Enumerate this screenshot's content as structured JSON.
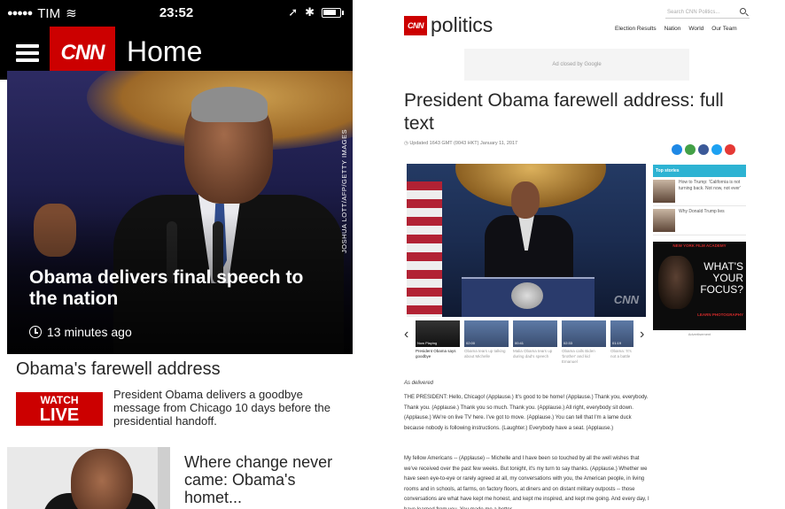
{
  "mobile": {
    "status_bar": {
      "signal": "●●●●●",
      "carrier": "TIM",
      "wifi": "≋",
      "time": "23:52",
      "location": "➚",
      "bluetooth": "✱"
    },
    "app_bar": {
      "logo": "CNN",
      "title": "Home"
    },
    "hero": {
      "headline": "Obama delivers final speech to the nation",
      "time_ago": "13 minutes ago",
      "photo_credit": "JOSHUA LOTT/AFP/GETTY IMAGES"
    },
    "section": {
      "title": "Obama's farewell address"
    },
    "watch_live": {
      "line1": "WATCH",
      "line2": "LIVE",
      "description": "President Obama delivers a goodbye message from Chicago 10 days before the presidential handoff."
    },
    "story2": {
      "title": "Where change never came: Obama's homet..."
    }
  },
  "web": {
    "logo_box": "CNN",
    "logo_word": "politics",
    "search_placeholder": "Search CNN Politics...",
    "nav": [
      "Election Results",
      "Nation",
      "World",
      "Our Team"
    ],
    "ad_banner": "Ad closed by Google",
    "article_title": "President Obama farewell address: full text",
    "article_meta": "Updated 1643 GMT (0043 HKT) January 11, 2017",
    "share_colors": [
      "#1e88e5",
      "#43a047",
      "#3b5998",
      "#1da1f2",
      "#e53935"
    ],
    "photo_watermark": "CNN",
    "carousel": [
      {
        "badge": "Now Playing",
        "caption": "President Obama says goodbye"
      },
      {
        "badge": "02:00",
        "caption": "Obama tears up talking about Michelle"
      },
      {
        "badge": "00:41",
        "caption": "Malia Obama tears up during dad's speech"
      },
      {
        "badge": "02:33",
        "caption": "Obama calls Biden 'brother' and kid Emanuel"
      },
      {
        "badge": "01:19",
        "caption": "Obama: 'It's not a battle"
      }
    ],
    "top_stories": {
      "header": "Top stories",
      "items": [
        "How to Trump: 'California is not turning back. Not now, not ever'",
        "Why Donald Trump lies"
      ]
    },
    "side_ad": {
      "top": "NEW YORK FILM ACADEMY",
      "main": "WHAT'S YOUR FOCUS?",
      "sub": "LEARN PHOTOGRAPHY",
      "label": "Advertisement"
    },
    "as_delivered": "As delivered",
    "paragraphs": [
      "THE PRESIDENT: Hello, Chicago! (Applause.) It's good to be home! (Applause.) Thank you, everybody. Thank you. (Applause.) Thank you so much. Thank you. (Applause.) All right, everybody sit down. (Applause.) We're on live TV here. I've got to move. (Applause.) You can tell that I'm a lame duck because nobody is following instructions. (Laughter.) Everybody have a seat. (Applause.)",
      "My fellow Americans -- (Applause) -- Michelle and I have been so touched by all the well wishes that we've received over the past few weeks. But tonight, it's my turn to say thanks. (Applause.) Whether we have seen eye-to-eye or rarely agreed at all, my conversations with you, the American people, in living rooms and in schools, at farms, on factory floors, at diners and on distant military outposts -- those conversations are what have kept me honest, and kept me inspired, and kept me going. And every day, I have learned from you. You made me a better"
    ]
  }
}
